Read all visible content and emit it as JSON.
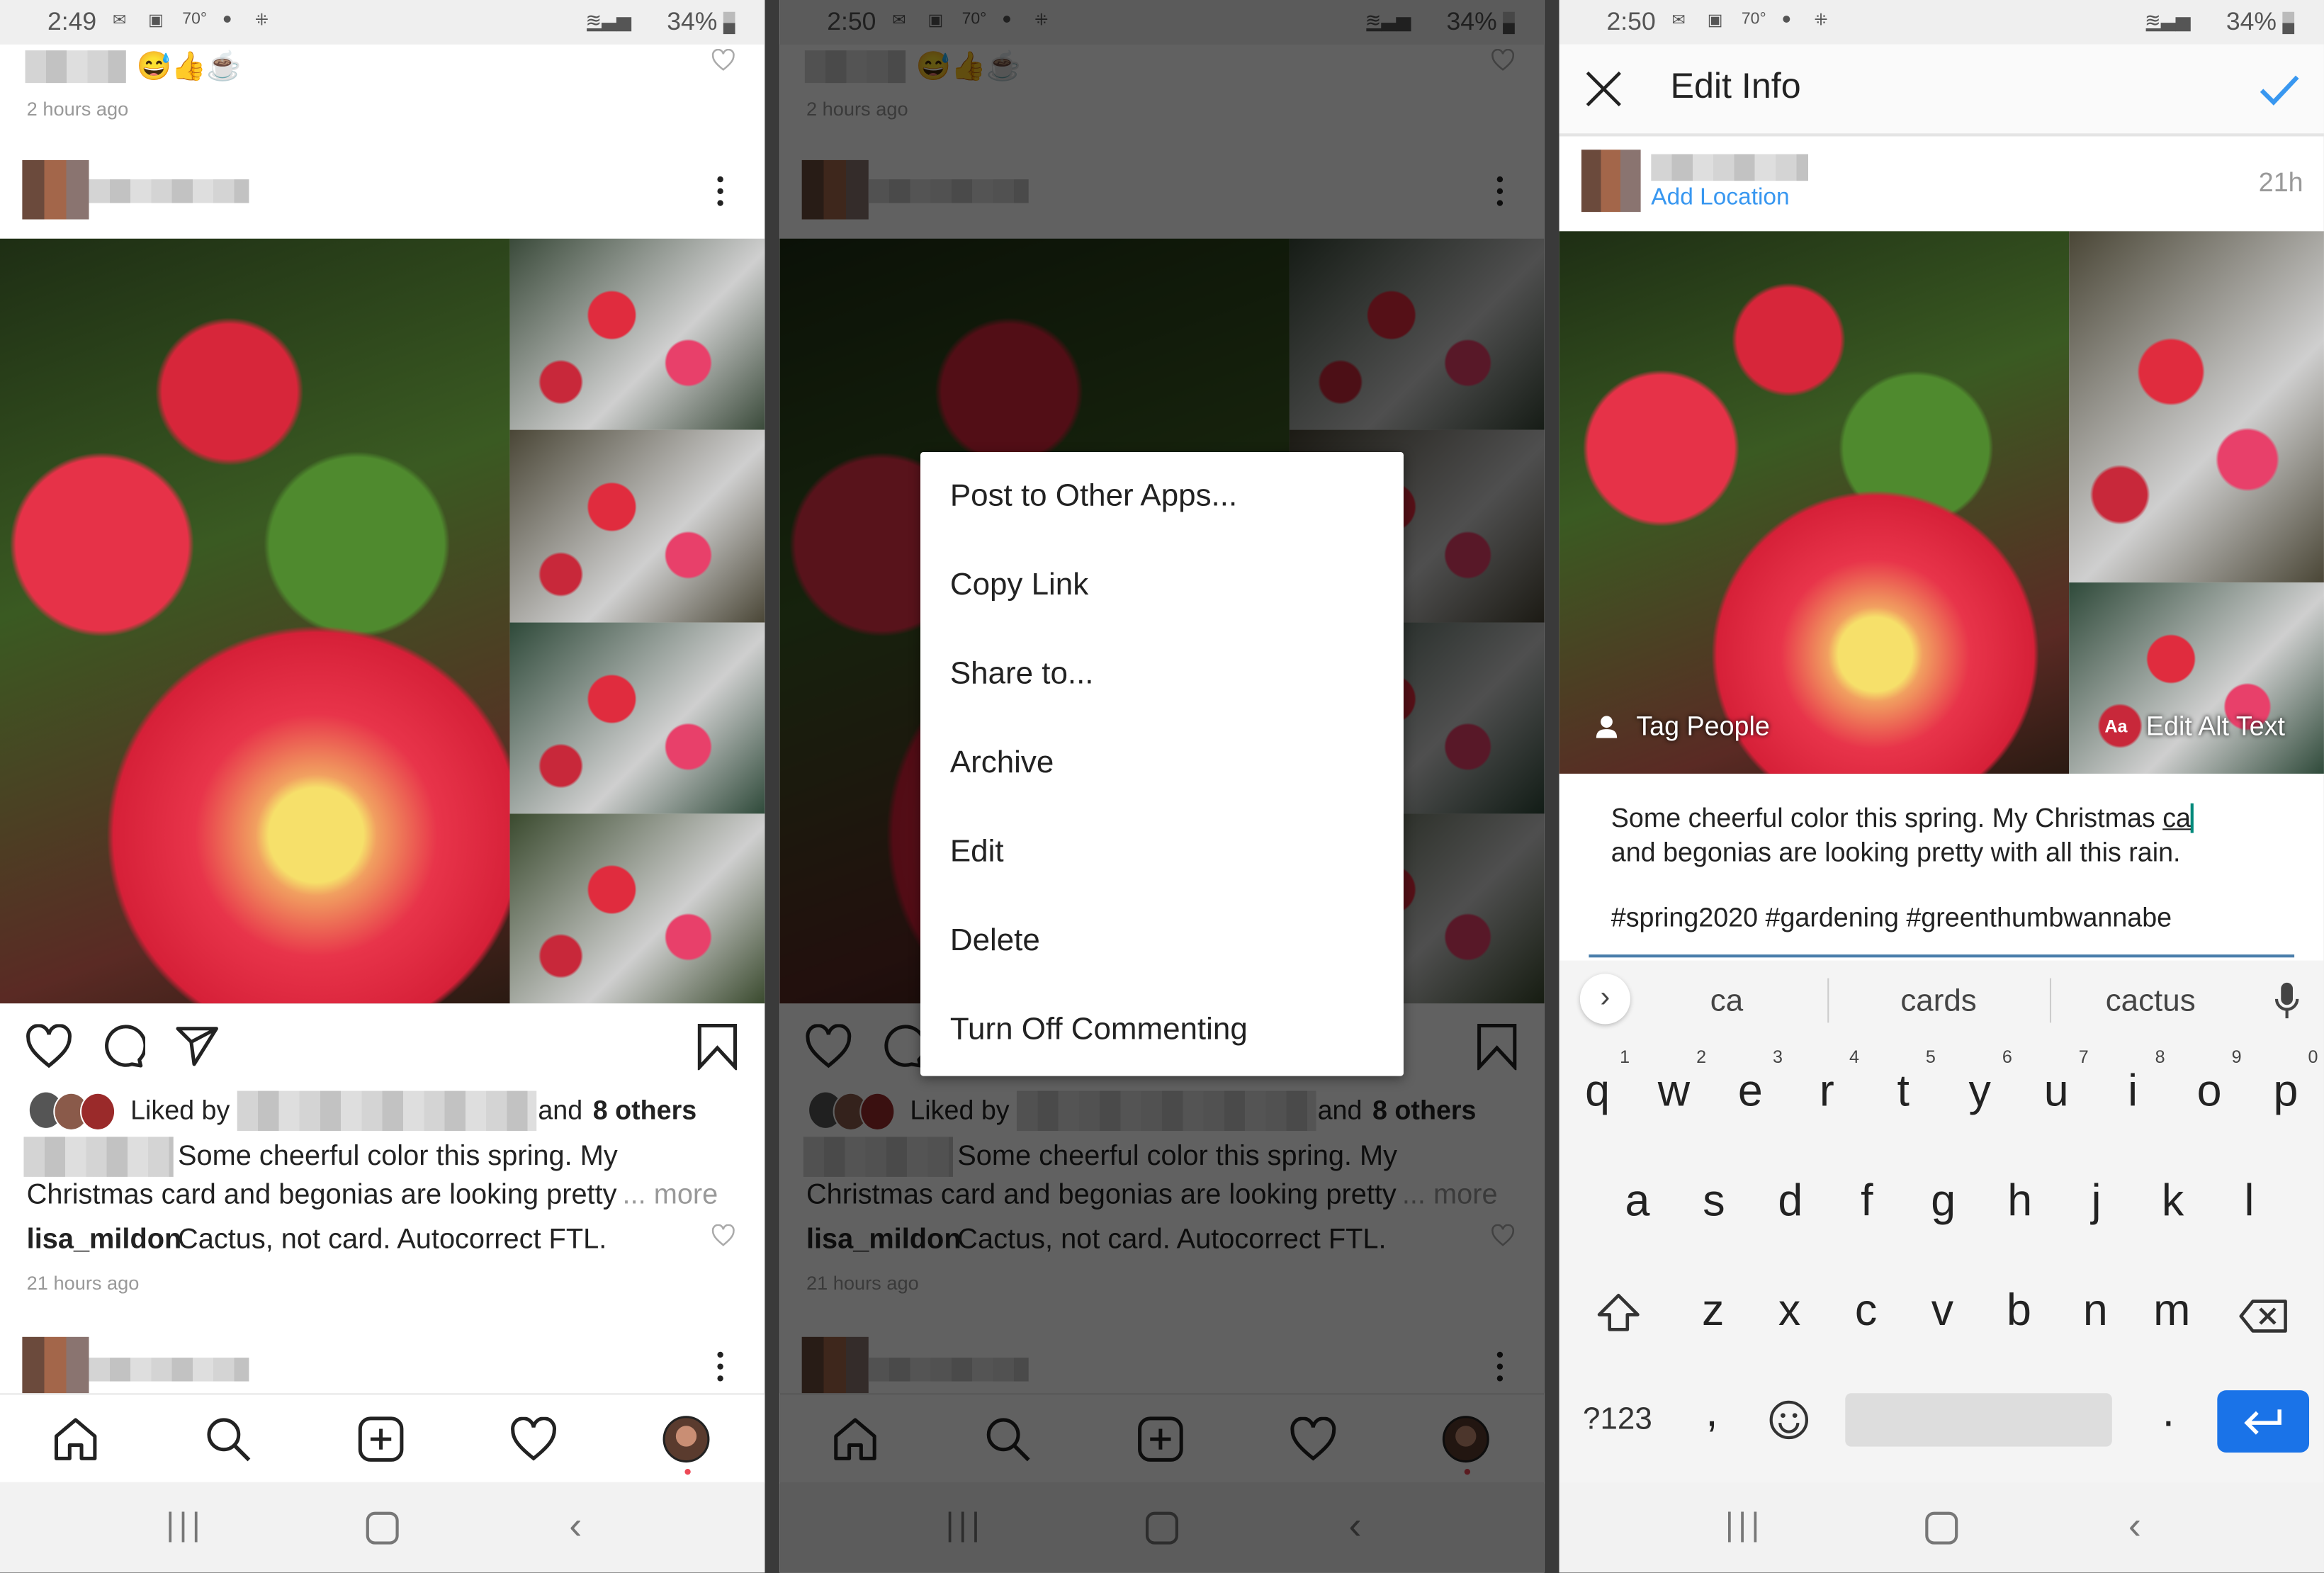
{
  "colors": {
    "accent_blue": "#3897f0",
    "enter_blue": "#1a73e8",
    "dim_overlay": "rgba(0,0,0,0.62)",
    "cursor": "#00897b"
  },
  "screens": [
    {
      "status": {
        "time": "2:49",
        "temp": "70°",
        "battery": "34%"
      }
    },
    {
      "status": {
        "time": "2:50",
        "temp": "70°",
        "battery": "34%"
      }
    },
    {
      "status": {
        "time": "2:50",
        "temp": "70°",
        "battery": "34%"
      }
    }
  ],
  "feed": {
    "prev_comment_time": "2 hours ago",
    "prev_comment_emoji": "😅👍☕",
    "liked_by": "Liked by",
    "and_label": "and",
    "others": "8 others",
    "caption_line1": "Some cheerful color this spring. My",
    "caption_line2": "Christmas card and begonias are looking pretty",
    "more": "... more",
    "comment_user": "lisa_mildon",
    "comment_text": "Cactus, not card.  Autocorrect FTL.",
    "post_time": "21 hours ago",
    "nav_icons": [
      "home-icon",
      "search-icon",
      "add-post-icon",
      "activity-heart-icon",
      "profile-avatar"
    ]
  },
  "menu": {
    "items": [
      "Post to Other Apps...",
      "Copy Link",
      "Share to...",
      "Archive",
      "Edit",
      "Delete",
      "Turn Off Commenting"
    ]
  },
  "edit": {
    "title": "Edit Info",
    "add_location": "Add Location",
    "time": "21h",
    "tag_people": "Tag People",
    "alt_prefix": "Aa",
    "edit_alt_text": "Edit Alt Text",
    "caption_line1": "Some cheerful color this spring. My Christmas ",
    "caption_typed": "ca",
    "caption_line2": "and begonias are looking pretty with all this rain.",
    "hashtags": "#spring2020 #gardening #greenthumbwannabe"
  },
  "keyboard": {
    "suggestions": [
      "ca",
      "cards",
      "cactus"
    ],
    "row1": [
      "q",
      "w",
      "e",
      "r",
      "t",
      "y",
      "u",
      "i",
      "o",
      "p"
    ],
    "row1_numbers": [
      "1",
      "2",
      "3",
      "4",
      "5",
      "6",
      "7",
      "8",
      "9",
      "0"
    ],
    "row2": [
      "a",
      "s",
      "d",
      "f",
      "g",
      "h",
      "j",
      "k",
      "l"
    ],
    "row3": [
      "z",
      "x",
      "c",
      "v",
      "b",
      "n",
      "m"
    ],
    "symbols_key": "?123",
    "comma": ",",
    "period": "."
  }
}
